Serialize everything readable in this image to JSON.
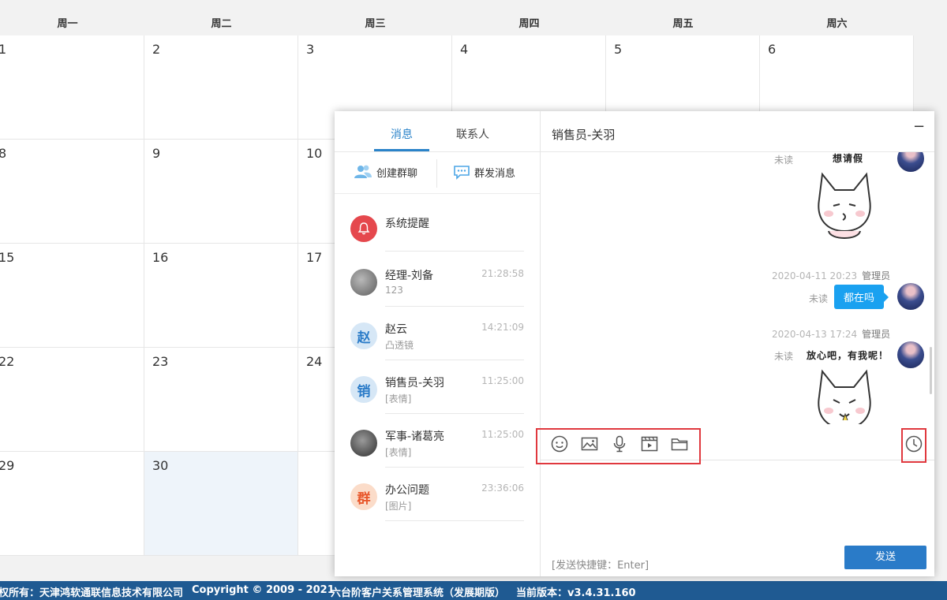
{
  "calendar": {
    "weekdays": [
      "周一",
      "周二",
      "周三",
      "周四",
      "周五",
      "周六"
    ],
    "rows": [
      [
        "1",
        "2",
        "3",
        "4",
        "5",
        "6"
      ],
      [
        "8",
        "9",
        "10",
        "",
        "",
        ""
      ],
      [
        "15",
        "16",
        "17",
        "",
        "",
        ""
      ],
      [
        "22",
        "23",
        "24",
        "",
        "",
        ""
      ],
      [
        "29",
        "30",
        "",
        "",
        "",
        ""
      ]
    ]
  },
  "footer": {
    "copyright_owner": "权所有：天津鸿软通联信息技术有限公司",
    "copyright": "Copyright © 2009 - 2021",
    "system": "六台阶客户关系管理系统（发展期版）",
    "version": "当前版本：v3.4.31.160"
  },
  "chat": {
    "tabs": [
      "消息",
      "联系人"
    ],
    "actions": {
      "create_group": "创建群聊",
      "broadcast": "群发消息"
    },
    "conversations": [
      {
        "name": "系统提醒",
        "time": "",
        "preview": "",
        "avatar_text": "",
        "avatar_color": "#e5484d"
      },
      {
        "name": "经理-刘备",
        "time": "21:28:58",
        "preview": "123",
        "avatar_text": "",
        "avatar_color": "#7a7a7a"
      },
      {
        "name": "赵云",
        "time": "14:21:09",
        "preview": "凸透镜",
        "avatar_text": "赵",
        "avatar_color": "#2a7bc8"
      },
      {
        "name": "销售员-关羽",
        "time": "11:25:00",
        "preview": "[表情]",
        "avatar_text": "销",
        "avatar_color": "#2a7bc8"
      },
      {
        "name": "军事-诸葛亮",
        "time": "11:25:00",
        "preview": "[表情]",
        "avatar_text": "",
        "avatar_color": "#4a4a4a"
      },
      {
        "name": "办公问题",
        "time": "23:36:06",
        "preview": "[图片]",
        "avatar_text": "群",
        "avatar_color": "#e8562a"
      }
    ],
    "title": "销售员-关羽",
    "minimize": "−",
    "messages": [
      {
        "time": "",
        "sender": "",
        "unread": "未读",
        "sticker_text": "想请假",
        "bubble": ""
      },
      {
        "time": "2020-04-11 20:23",
        "sender": "管理员",
        "unread": "未读",
        "sticker_text": "",
        "bubble": "都在吗"
      },
      {
        "time": "2020-04-13 17:24",
        "sender": "管理员",
        "unread": "未读",
        "sticker_text": "放心吧，有我呢！",
        "bubble": ""
      }
    ],
    "send_hint": "[发送快捷键：Enter]",
    "send_label": "发送",
    "highlight_color": "#e0383e",
    "accent": "#2a83c9"
  }
}
